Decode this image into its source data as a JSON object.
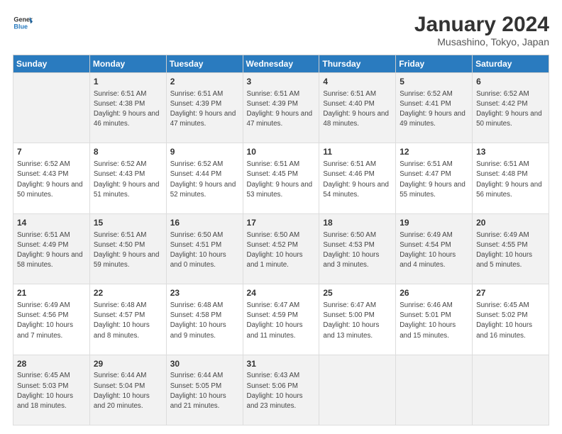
{
  "logo": {
    "line1": "General",
    "line2": "Blue",
    "icon_color": "#2a7bbf"
  },
  "header": {
    "title": "January 2024",
    "subtitle": "Musashino, Tokyo, Japan"
  },
  "weekdays": [
    "Sunday",
    "Monday",
    "Tuesday",
    "Wednesday",
    "Thursday",
    "Friday",
    "Saturday"
  ],
  "weeks": [
    [
      {
        "day": "",
        "sunrise": "",
        "sunset": "",
        "daylight": ""
      },
      {
        "day": "1",
        "sunrise": "Sunrise: 6:51 AM",
        "sunset": "Sunset: 4:38 PM",
        "daylight": "Daylight: 9 hours and 46 minutes."
      },
      {
        "day": "2",
        "sunrise": "Sunrise: 6:51 AM",
        "sunset": "Sunset: 4:39 PM",
        "daylight": "Daylight: 9 hours and 47 minutes."
      },
      {
        "day": "3",
        "sunrise": "Sunrise: 6:51 AM",
        "sunset": "Sunset: 4:39 PM",
        "daylight": "Daylight: 9 hours and 47 minutes."
      },
      {
        "day": "4",
        "sunrise": "Sunrise: 6:51 AM",
        "sunset": "Sunset: 4:40 PM",
        "daylight": "Daylight: 9 hours and 48 minutes."
      },
      {
        "day": "5",
        "sunrise": "Sunrise: 6:52 AM",
        "sunset": "Sunset: 4:41 PM",
        "daylight": "Daylight: 9 hours and 49 minutes."
      },
      {
        "day": "6",
        "sunrise": "Sunrise: 6:52 AM",
        "sunset": "Sunset: 4:42 PM",
        "daylight": "Daylight: 9 hours and 50 minutes."
      }
    ],
    [
      {
        "day": "7",
        "sunrise": "Sunrise: 6:52 AM",
        "sunset": "Sunset: 4:43 PM",
        "daylight": "Daylight: 9 hours and 50 minutes."
      },
      {
        "day": "8",
        "sunrise": "Sunrise: 6:52 AM",
        "sunset": "Sunset: 4:43 PM",
        "daylight": "Daylight: 9 hours and 51 minutes."
      },
      {
        "day": "9",
        "sunrise": "Sunrise: 6:52 AM",
        "sunset": "Sunset: 4:44 PM",
        "daylight": "Daylight: 9 hours and 52 minutes."
      },
      {
        "day": "10",
        "sunrise": "Sunrise: 6:51 AM",
        "sunset": "Sunset: 4:45 PM",
        "daylight": "Daylight: 9 hours and 53 minutes."
      },
      {
        "day": "11",
        "sunrise": "Sunrise: 6:51 AM",
        "sunset": "Sunset: 4:46 PM",
        "daylight": "Daylight: 9 hours and 54 minutes."
      },
      {
        "day": "12",
        "sunrise": "Sunrise: 6:51 AM",
        "sunset": "Sunset: 4:47 PM",
        "daylight": "Daylight: 9 hours and 55 minutes."
      },
      {
        "day": "13",
        "sunrise": "Sunrise: 6:51 AM",
        "sunset": "Sunset: 4:48 PM",
        "daylight": "Daylight: 9 hours and 56 minutes."
      }
    ],
    [
      {
        "day": "14",
        "sunrise": "Sunrise: 6:51 AM",
        "sunset": "Sunset: 4:49 PM",
        "daylight": "Daylight: 9 hours and 58 minutes."
      },
      {
        "day": "15",
        "sunrise": "Sunrise: 6:51 AM",
        "sunset": "Sunset: 4:50 PM",
        "daylight": "Daylight: 9 hours and 59 minutes."
      },
      {
        "day": "16",
        "sunrise": "Sunrise: 6:50 AM",
        "sunset": "Sunset: 4:51 PM",
        "daylight": "Daylight: 10 hours and 0 minutes."
      },
      {
        "day": "17",
        "sunrise": "Sunrise: 6:50 AM",
        "sunset": "Sunset: 4:52 PM",
        "daylight": "Daylight: 10 hours and 1 minute."
      },
      {
        "day": "18",
        "sunrise": "Sunrise: 6:50 AM",
        "sunset": "Sunset: 4:53 PM",
        "daylight": "Daylight: 10 hours and 3 minutes."
      },
      {
        "day": "19",
        "sunrise": "Sunrise: 6:49 AM",
        "sunset": "Sunset: 4:54 PM",
        "daylight": "Daylight: 10 hours and 4 minutes."
      },
      {
        "day": "20",
        "sunrise": "Sunrise: 6:49 AM",
        "sunset": "Sunset: 4:55 PM",
        "daylight": "Daylight: 10 hours and 5 minutes."
      }
    ],
    [
      {
        "day": "21",
        "sunrise": "Sunrise: 6:49 AM",
        "sunset": "Sunset: 4:56 PM",
        "daylight": "Daylight: 10 hours and 7 minutes."
      },
      {
        "day": "22",
        "sunrise": "Sunrise: 6:48 AM",
        "sunset": "Sunset: 4:57 PM",
        "daylight": "Daylight: 10 hours and 8 minutes."
      },
      {
        "day": "23",
        "sunrise": "Sunrise: 6:48 AM",
        "sunset": "Sunset: 4:58 PM",
        "daylight": "Daylight: 10 hours and 9 minutes."
      },
      {
        "day": "24",
        "sunrise": "Sunrise: 6:47 AM",
        "sunset": "Sunset: 4:59 PM",
        "daylight": "Daylight: 10 hours and 11 minutes."
      },
      {
        "day": "25",
        "sunrise": "Sunrise: 6:47 AM",
        "sunset": "Sunset: 5:00 PM",
        "daylight": "Daylight: 10 hours and 13 minutes."
      },
      {
        "day": "26",
        "sunrise": "Sunrise: 6:46 AM",
        "sunset": "Sunset: 5:01 PM",
        "daylight": "Daylight: 10 hours and 15 minutes."
      },
      {
        "day": "27",
        "sunrise": "Sunrise: 6:45 AM",
        "sunset": "Sunset: 5:02 PM",
        "daylight": "Daylight: 10 hours and 16 minutes."
      }
    ],
    [
      {
        "day": "28",
        "sunrise": "Sunrise: 6:45 AM",
        "sunset": "Sunset: 5:03 PM",
        "daylight": "Daylight: 10 hours and 18 minutes."
      },
      {
        "day": "29",
        "sunrise": "Sunrise: 6:44 AM",
        "sunset": "Sunset: 5:04 PM",
        "daylight": "Daylight: 10 hours and 20 minutes."
      },
      {
        "day": "30",
        "sunrise": "Sunrise: 6:44 AM",
        "sunset": "Sunset: 5:05 PM",
        "daylight": "Daylight: 10 hours and 21 minutes."
      },
      {
        "day": "31",
        "sunrise": "Sunrise: 6:43 AM",
        "sunset": "Sunset: 5:06 PM",
        "daylight": "Daylight: 10 hours and 23 minutes."
      },
      {
        "day": "",
        "sunrise": "",
        "sunset": "",
        "daylight": ""
      },
      {
        "day": "",
        "sunrise": "",
        "sunset": "",
        "daylight": ""
      },
      {
        "day": "",
        "sunrise": "",
        "sunset": "",
        "daylight": ""
      }
    ]
  ]
}
